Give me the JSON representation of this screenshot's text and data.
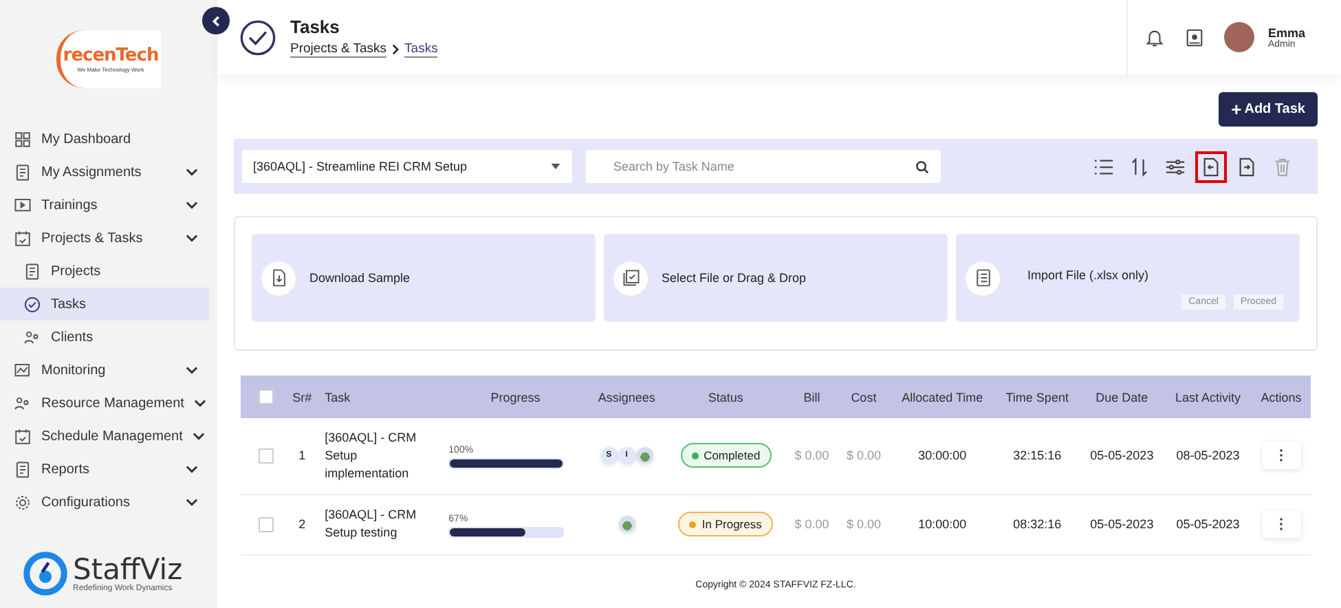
{
  "sidebar": {
    "brand_logo": {
      "name": "recenTech",
      "tagline": "We Make Technology Work"
    },
    "items": [
      {
        "label": "My Dashboard",
        "expandable": false,
        "selected": false,
        "sub": false
      },
      {
        "label": "My Assignments",
        "expandable": true,
        "selected": false,
        "sub": false
      },
      {
        "label": "Trainings",
        "expandable": true,
        "selected": false,
        "sub": false
      },
      {
        "label": "Projects & Tasks",
        "expandable": true,
        "selected": false,
        "sub": false
      },
      {
        "label": "Projects",
        "expandable": false,
        "selected": false,
        "sub": true
      },
      {
        "label": "Tasks",
        "expandable": false,
        "selected": true,
        "sub": true
      },
      {
        "label": "Clients",
        "expandable": false,
        "selected": false,
        "sub": true
      },
      {
        "label": "Monitoring",
        "expandable": true,
        "selected": false,
        "sub": false
      },
      {
        "label": "Resource Management",
        "expandable": true,
        "selected": false,
        "sub": false
      },
      {
        "label": "Schedule Management",
        "expandable": true,
        "selected": false,
        "sub": false
      },
      {
        "label": "Reports",
        "expandable": true,
        "selected": false,
        "sub": false
      },
      {
        "label": "Configurations",
        "expandable": true,
        "selected": false,
        "sub": false
      }
    ],
    "footer_logo": {
      "name": "StaffViz",
      "tagline": "Redefining Work Dynamics"
    }
  },
  "header": {
    "title": "Tasks",
    "breadcrumb": [
      "Projects & Tasks",
      "Tasks"
    ],
    "user": {
      "name": "Emma",
      "role": "Admin"
    }
  },
  "add_button": {
    "icon": "+",
    "label": "Add Task"
  },
  "filter_bar": {
    "project": "[360AQL] - Streamline REI CRM Setup",
    "search": {
      "placeholder": "Search by Task Name"
    },
    "tools": [
      {
        "kind": "list",
        "highlighted": false,
        "disabled": false
      },
      {
        "kind": "sort",
        "highlighted": false,
        "disabled": false
      },
      {
        "kind": "filter",
        "highlighted": false,
        "disabled": false
      },
      {
        "kind": "import",
        "highlighted": true,
        "disabled": false
      },
      {
        "kind": "export",
        "highlighted": false,
        "disabled": false
      },
      {
        "kind": "delete",
        "highlighted": false,
        "disabled": true
      }
    ]
  },
  "import_panel": {
    "cards": [
      {
        "kind": "download",
        "label": "Download Sample"
      },
      {
        "kind": "select",
        "label": "Select File or Drag & Drop"
      },
      {
        "kind": "import",
        "label": "Import File (.xlsx only)"
      }
    ],
    "buttons": [
      {
        "label": "Cancel",
        "disabled": true
      },
      {
        "label": "Proceed",
        "disabled": true
      }
    ]
  },
  "table": {
    "all_checked": false,
    "columns": [
      "Sr#",
      "Task",
      "Progress",
      "Assignees",
      "Status",
      "Bill",
      "Cost",
      "Allocated Time",
      "Time Spent",
      "Due Date",
      "Last Activity",
      "Actions"
    ],
    "rows": [
      {
        "checked": false,
        "sr": "1",
        "task": "[360AQL] - CRM Setup implementation",
        "progress_label": "100%",
        "level": 1,
        "assignees": [
          {
            "kind": "initial",
            "text": "S"
          },
          {
            "kind": "initial",
            "text": "I"
          },
          {
            "kind": "photo"
          }
        ],
        "status": {
          "kind": "completed",
          "label": "Completed"
        },
        "bill": "$ 0.00",
        "cost": "$ 0.00",
        "allocated": "30:00:00",
        "spent": "32:15:16",
        "due": "05-05-2023",
        "last": "08-05-2023",
        "action": "⋮"
      },
      {
        "checked": false,
        "sr": "2",
        "task": "[360AQL] - CRM Setup testing",
        "progress_label": "67%",
        "level": 0.67,
        "assignees": [
          {
            "kind": "photo"
          }
        ],
        "status": {
          "kind": "progress",
          "label": "In Progress"
        },
        "bill": "$ 0.00",
        "cost": "$ 0.00",
        "allocated": "10:00:00",
        "spent": "08:32:16",
        "due": "05-05-2023",
        "last": "05-05-2023",
        "action": "⋮"
      }
    ]
  },
  "footer": "Copyright © 2024 STAFFVIZ FZ-LLC."
}
